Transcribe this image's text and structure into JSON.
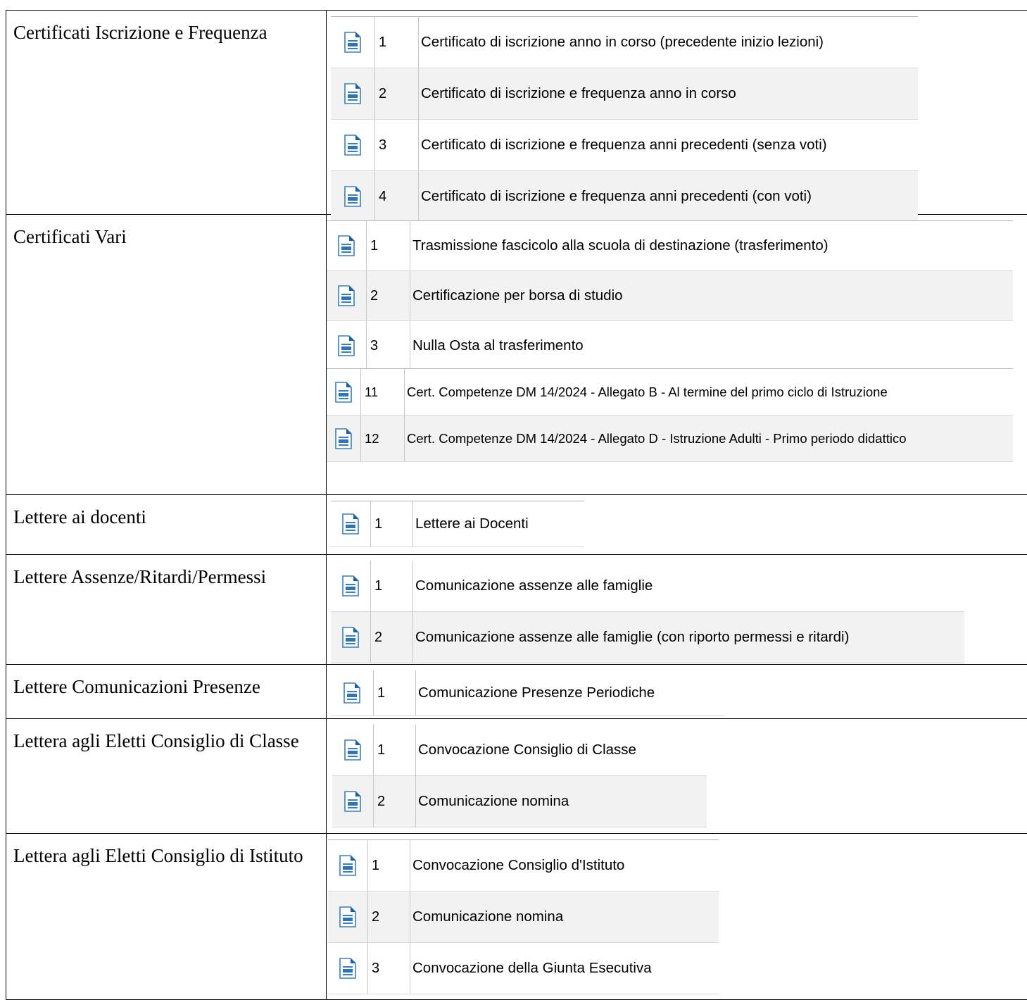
{
  "sections": [
    {
      "label": "Certificati Iscrizione e Frequenza",
      "items": [
        {
          "num": "1",
          "text": "Certificato di iscrizione anno in corso (precedente inizio lezioni)"
        },
        {
          "num": "2",
          "text": "Certificato di iscrizione e frequenza anno in corso"
        },
        {
          "num": "3",
          "text": "Certificato di iscrizione e frequenza anni precedenti (senza voti)"
        },
        {
          "num": "4",
          "text": "Certificato di iscrizione e frequenza anni precedenti (con voti)"
        }
      ]
    },
    {
      "label": "Certificati Vari",
      "items": [
        {
          "num": "1",
          "text": "Trasmissione fascicolo alla scuola di destinazione (trasferimento)"
        },
        {
          "num": "2",
          "text": "Certificazione per borsa di studio"
        },
        {
          "num": "3",
          "text": "Nulla Osta al trasferimento"
        }
      ],
      "items_extra": [
        {
          "num": "11",
          "text": "Cert. Competenze DM 14/2024 - Allegato B - Al termine del primo ciclo di Istruzione"
        },
        {
          "num": "12",
          "text": "Cert. Competenze DM 14/2024 - Allegato D - Istruzione Adulti - Primo periodo didattico"
        }
      ]
    },
    {
      "label": "Lettere ai docenti",
      "items": [
        {
          "num": "1",
          "text": "Lettere ai Docenti"
        }
      ]
    },
    {
      "label": "Lettere Assenze/Ritardi/Permessi",
      "items": [
        {
          "num": "1",
          "text": "Comunicazione assenze alle famiglie"
        },
        {
          "num": "2",
          "text": "Comunicazione assenze alle famiglie (con riporto permessi e ritardi)"
        }
      ]
    },
    {
      "label": "Lettere Comunicazioni Presenze",
      "items": [
        {
          "num": "1",
          "text": "Comunicazione Presenze Periodiche"
        }
      ]
    },
    {
      "label": "Lettera agli Eletti Consiglio di Classe",
      "items": [
        {
          "num": "1",
          "text": "Convocazione Consiglio di Classe"
        },
        {
          "num": "2",
          "text": "Comunicazione nomina"
        }
      ]
    },
    {
      "label": "Lettera agli Eletti Consiglio di Istituto",
      "items": [
        {
          "num": "1",
          "text": "Convocazione Consiglio d'Istituto"
        },
        {
          "num": "2",
          "text": "Comunicazione nomina"
        },
        {
          "num": "3",
          "text": "Convocazione della Giunta Esecutiva"
        }
      ]
    }
  ],
  "icon": "writer-document-icon"
}
